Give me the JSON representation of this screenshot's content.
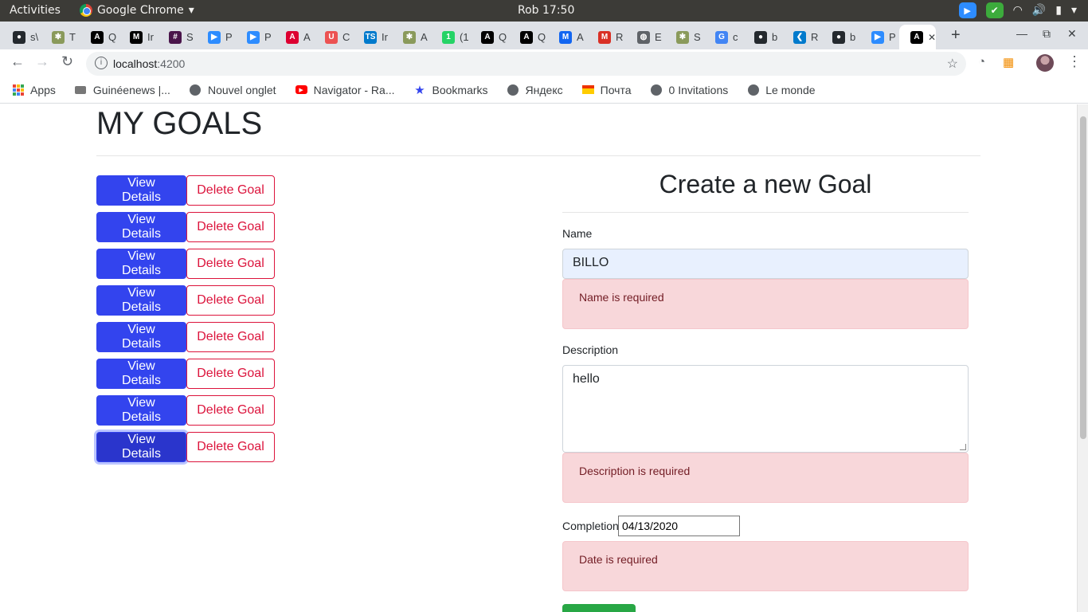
{
  "system_bar": {
    "activities": "Activities",
    "app_name": "Google Chrome",
    "clock": "Rob 17:50"
  },
  "tabs": [
    {
      "icon": "github-icon",
      "label": "s\\",
      "color": "#24292e"
    },
    {
      "icon": "palm-tree-icon",
      "label": "T",
      "color": "#8a9a5b"
    },
    {
      "icon": "angular-icon",
      "label": "Q",
      "color": "#000000"
    },
    {
      "icon": "medium-icon",
      "label": "Ir",
      "color": "#000000"
    },
    {
      "icon": "slack-icon",
      "label": "S",
      "color": "#4a154b"
    },
    {
      "icon": "zoom-icon",
      "label": "P",
      "color": "#2d8cff"
    },
    {
      "icon": "zoom-icon",
      "label": "P",
      "color": "#2d8cff"
    },
    {
      "icon": "angular-red-icon",
      "label": "A",
      "color": "#dd0031"
    },
    {
      "icon": "udemy-icon",
      "label": "C",
      "color": "#ec5252"
    },
    {
      "icon": "typescript-icon",
      "label": "Ir",
      "color": "#007acc"
    },
    {
      "icon": "palm-tree-icon",
      "label": "A",
      "color": "#8a9a5b"
    },
    {
      "icon": "whatsapp-icon",
      "label": "(1",
      "color": "#25d366"
    },
    {
      "icon": "angular-icon",
      "label": "Q",
      "color": "#000000"
    },
    {
      "icon": "angular-icon",
      "label": "Q",
      "color": "#000000"
    },
    {
      "icon": "mdb-icon",
      "label": "A",
      "color": "#1266f1"
    },
    {
      "icon": "gmail-icon",
      "label": "R",
      "color": "#d93025"
    },
    {
      "icon": "globe-icon",
      "label": "E",
      "color": "#5f6368"
    },
    {
      "icon": "palm-tree-icon",
      "label": "S",
      "color": "#8a9a5b"
    },
    {
      "icon": "google-icon",
      "label": "c",
      "color": "#4285f4"
    },
    {
      "icon": "github-icon",
      "label": "b",
      "color": "#24292e"
    },
    {
      "icon": "vscode-icon",
      "label": "R",
      "color": "#007acc"
    },
    {
      "icon": "github-icon",
      "label": "b",
      "color": "#24292e"
    },
    {
      "icon": "zoom-icon",
      "label": "P",
      "color": "#2d8cff"
    },
    {
      "icon": "angular-icon",
      "label": "",
      "color": "#000000",
      "active": true
    }
  ],
  "address_bar": {
    "host": "localhost",
    "port": ":4200"
  },
  "bookmarks": [
    {
      "icon": "apps-icon",
      "label": "Apps"
    },
    {
      "icon": "guineenews-icon",
      "label": "Guinéenews |..."
    },
    {
      "icon": "globe-icon",
      "label": "Nouvel onglet"
    },
    {
      "icon": "youtube-icon",
      "label": "Navigator - Ra..."
    },
    {
      "icon": "star-icon",
      "label": "Bookmarks"
    },
    {
      "icon": "globe-icon",
      "label": "Яндекс"
    },
    {
      "icon": "mail-icon",
      "label": "Почта"
    },
    {
      "icon": "globe-icon",
      "label": "0 Invitations"
    },
    {
      "icon": "globe-icon",
      "label": "Le monde"
    }
  ],
  "page": {
    "title": "MY GOALS",
    "goals": [
      {
        "view_label": "View Details",
        "delete_label": "Delete Goal"
      },
      {
        "view_label": "View Details",
        "delete_label": "Delete Goal"
      },
      {
        "view_label": "View Details",
        "delete_label": "Delete Goal"
      },
      {
        "view_label": "View Details",
        "delete_label": "Delete Goal"
      },
      {
        "view_label": "View Details",
        "delete_label": "Delete Goal"
      },
      {
        "view_label": "View Details",
        "delete_label": "Delete Goal"
      },
      {
        "view_label": "View Details",
        "delete_label": "Delete Goal"
      },
      {
        "view_label": "View Details",
        "delete_label": "Delete Goal",
        "focused": true
      }
    ],
    "form": {
      "heading": "Create a new Goal",
      "name_label": "Name",
      "name_value": "BILLO",
      "name_error": "Name is required",
      "description_label": "Description",
      "description_value": "hello",
      "description_error": "Description is required",
      "completion_label": "Completion",
      "completion_value": "04/13/2020",
      "date_error": "Date is required"
    }
  },
  "colors": {
    "primary": "#3344ee",
    "danger": "#dc143c",
    "alert_bg": "#f8d7da",
    "success": "#28a745"
  }
}
